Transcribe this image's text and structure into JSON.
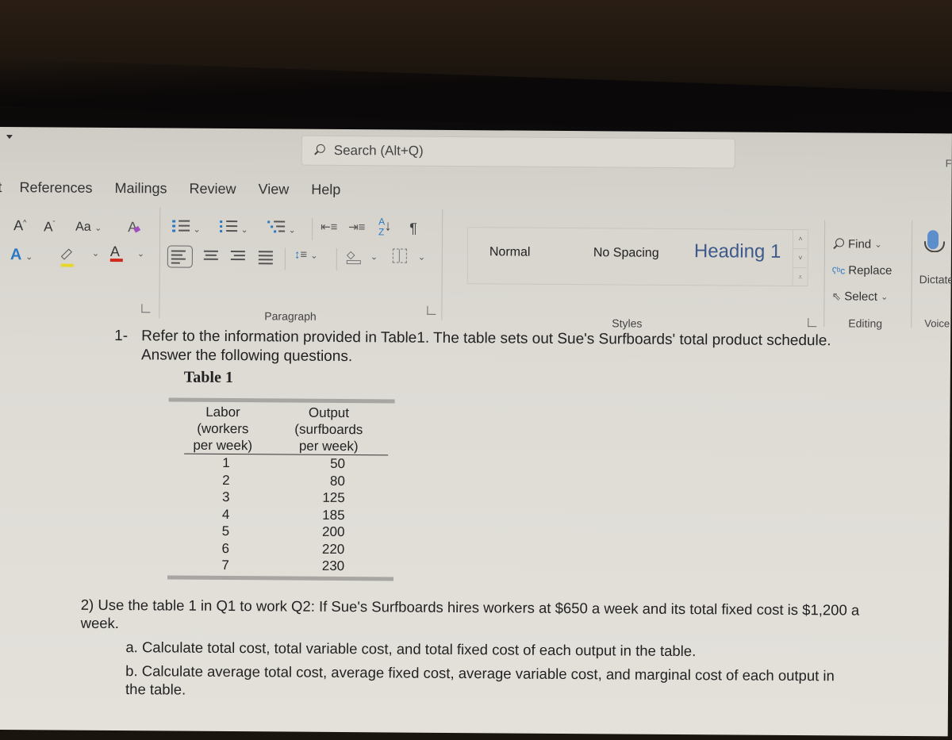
{
  "window": {
    "search_placeholder": "Search (Alt+Q)",
    "partial_right_label": "F"
  },
  "tabs": [
    {
      "label": "t"
    },
    {
      "label": "References"
    },
    {
      "label": "Mailings"
    },
    {
      "label": "Review"
    },
    {
      "label": "View"
    },
    {
      "label": "Help"
    }
  ],
  "ribbon": {
    "font_group": {
      "grow_font": "A",
      "shrink_font": "A",
      "change_case": "Aa",
      "text_effects": "A",
      "font_color": "A",
      "highlight_color": "#e8d62a",
      "font_color_swatch": "#d02a1f"
    },
    "paragraph_group_label": "Paragraph",
    "sort_label": "A Z",
    "pilcrow": "¶",
    "styles": {
      "items": [
        "Normal",
        "No Spacing",
        "Heading 1"
      ],
      "group_label": "Styles"
    },
    "editing": {
      "find": "Find",
      "replace": "Replace",
      "select": "Select",
      "group_label": "Editing"
    },
    "voice": {
      "dictate": "Dictate",
      "group_label": "Voice"
    }
  },
  "document": {
    "q1_number": "1-",
    "q1_text": "Refer to the information provided in Table1. The table sets out Sue's Surfboards' total product schedule. Answer the following questions.",
    "table_title": "Table 1",
    "table": {
      "headers": [
        "Labor (workers per week)",
        "Output (surfboards per week)"
      ],
      "header_lines": [
        [
          "Labor",
          "(workers",
          "per week)"
        ],
        [
          "Output",
          "(surfboards",
          "per week)"
        ]
      ],
      "rows": [
        [
          "1",
          "50"
        ],
        [
          "2",
          "80"
        ],
        [
          "3",
          "125"
        ],
        [
          "4",
          "185"
        ],
        [
          "5",
          "200"
        ],
        [
          "6",
          "220"
        ],
        [
          "7",
          "230"
        ]
      ]
    },
    "q2_text": "2) Use the table 1 in Q1 to work Q2: If Sue's Surfboards hires workers at $650 a week and its total fixed cost is $1,200 a week.",
    "q2_a": "a. Calculate total cost, total variable cost, and total fixed cost of each output in the table.",
    "q2_b": "b. Calculate average total cost, average fixed cost, average variable cost, and marginal cost of each output in the table."
  }
}
